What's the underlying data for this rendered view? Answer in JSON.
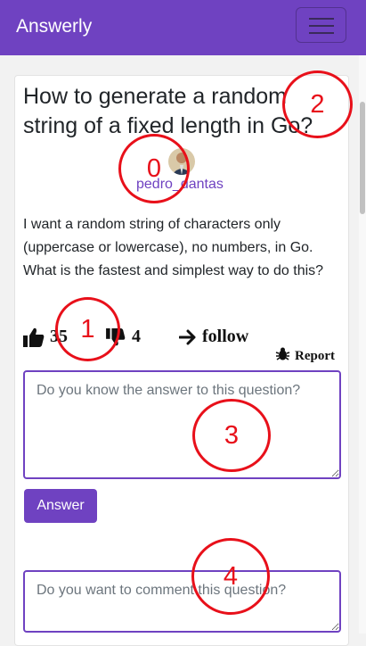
{
  "navbar": {
    "brand": "Answerly",
    "toggler_icon": "hamburger-menu-icon",
    "color": "#6f42c1"
  },
  "question": {
    "title": "How to generate a random string of a fixed length in Go?",
    "author": "pedro_dantas",
    "body": "I want a random string of characters only (uppercase or lowercase), no numbers, in Go. What is the fastest and simplest way to do this?",
    "upvotes": "35",
    "downvotes": "4",
    "follow_label": "follow",
    "report_label": "Report"
  },
  "answer_form": {
    "placeholder": "Do you know the answer to this question?",
    "button_label": "Answer"
  },
  "comment_form": {
    "placeholder": "Do you want to comment this question?"
  },
  "annotations": {
    "marker_color": "#e8101a",
    "markers": [
      "0",
      "1",
      "2",
      "3",
      "4"
    ]
  }
}
